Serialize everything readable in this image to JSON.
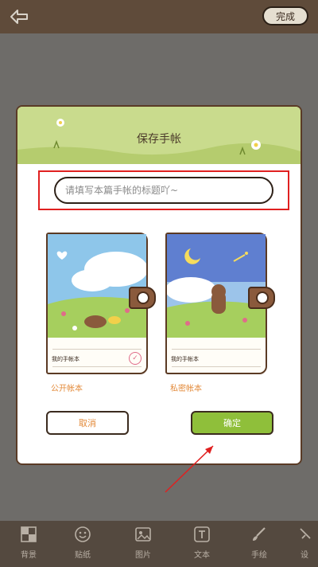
{
  "topbar": {
    "done_label": "完成"
  },
  "dialog": {
    "title": "保存手帐",
    "title_placeholder": "请填写本篇手帐的标题吖~",
    "public_book": {
      "label": "公开帐本",
      "note": "我的手帐本"
    },
    "private_book": {
      "label": "私密帐本",
      "note": "我的手帐本"
    },
    "cancel_label": "取消",
    "confirm_label": "确定"
  },
  "bottombar": {
    "tools": [
      {
        "label": "背景",
        "icon": "background-icon"
      },
      {
        "label": "贴纸",
        "icon": "sticker-icon"
      },
      {
        "label": "图片",
        "icon": "image-icon"
      },
      {
        "label": "文本",
        "icon": "text-icon"
      },
      {
        "label": "手绘",
        "icon": "brush-icon"
      },
      {
        "label": "设",
        "icon": "settings-icon"
      }
    ]
  },
  "colors": {
    "accent_green": "#8fbf3a",
    "header_green": "#c9db8d",
    "highlight_red": "#e02020",
    "label_orange": "#e38b3b"
  }
}
